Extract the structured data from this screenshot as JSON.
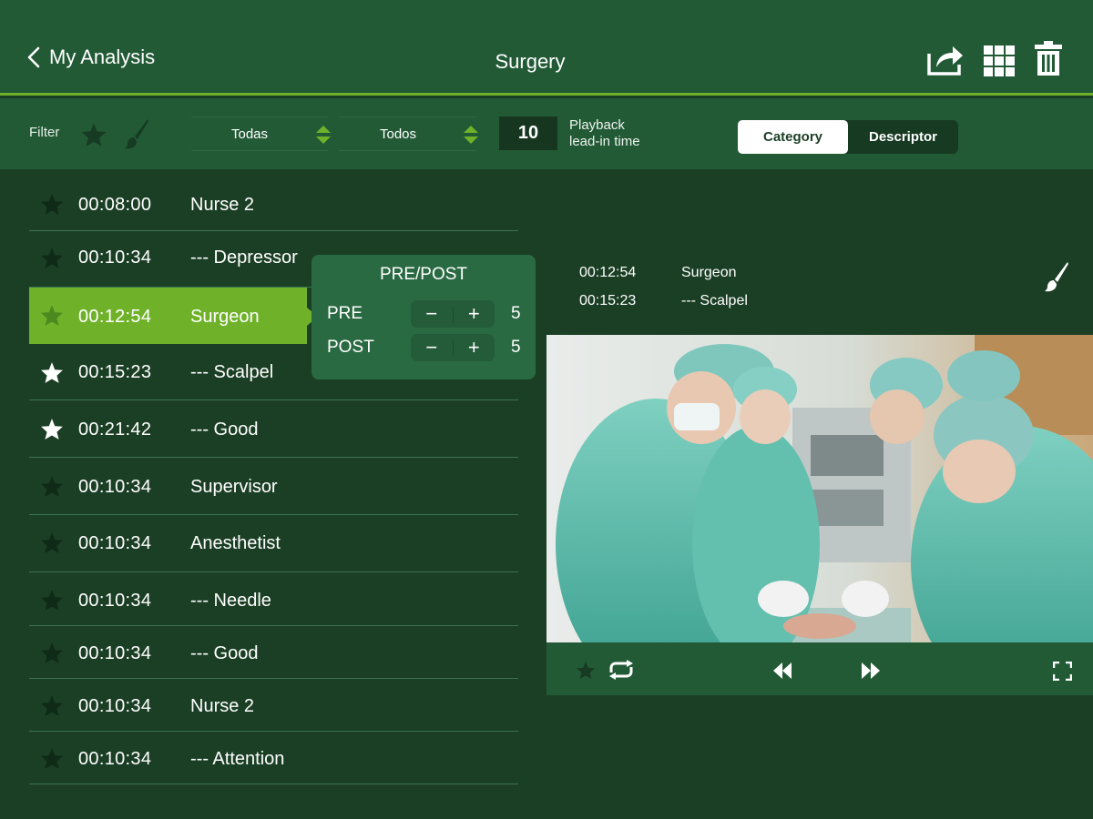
{
  "header": {
    "back_label": "My Analysis",
    "title": "Surgery",
    "icons": [
      "share-icon",
      "grid-icon",
      "trash-icon"
    ]
  },
  "filter": {
    "label": "Filter",
    "select_1": "Todas",
    "select_2": "Todos",
    "lead_in_value": "10",
    "lead_in_label_line1": "Playback",
    "lead_in_label_line2": "lead-in time",
    "segment_active": "Category",
    "segment_inactive": "Descriptor"
  },
  "list": [
    {
      "time": "00:08:00",
      "name": "Nurse 2",
      "star": "dark"
    },
    {
      "time": "00:10:34",
      "name": "--- Depressor",
      "star": "dark"
    },
    {
      "time": "00:12:54",
      "name": "Surgeon",
      "star": "dark",
      "selected": true
    },
    {
      "time": "00:15:23",
      "name": "--- Scalpel",
      "star": "white"
    },
    {
      "time": "00:21:42",
      "name": "--- Good",
      "star": "white"
    },
    {
      "time": "00:10:34",
      "name": "Supervisor",
      "star": "dark"
    },
    {
      "time": "00:10:34",
      "name": "Anesthetist",
      "star": "dark"
    },
    {
      "time": "00:10:34",
      "name": "--- Needle",
      "star": "dark"
    },
    {
      "time": "00:10:34",
      "name": "--- Good",
      "star": "dark"
    },
    {
      "time": "00:10:34",
      "name": "Nurse 2",
      "star": "dark"
    },
    {
      "time": "00:10:34",
      "name": "--- Attention",
      "star": "dark"
    }
  ],
  "popup": {
    "title": "PRE/POST",
    "pre_label": "PRE",
    "pre_value": "5",
    "post_label": "POST",
    "post_value": "5",
    "minus": "−",
    "plus": "+"
  },
  "detail": {
    "line1_time": "00:12:54",
    "line1_name": "Surgeon",
    "line2_time": "00:15:23",
    "line2_name": "--- Scalpel"
  },
  "colors": {
    "background": "#1b3f25",
    "bar": "#225a36",
    "accent": "#6fb22a",
    "selected_row": "#6fb22a"
  }
}
